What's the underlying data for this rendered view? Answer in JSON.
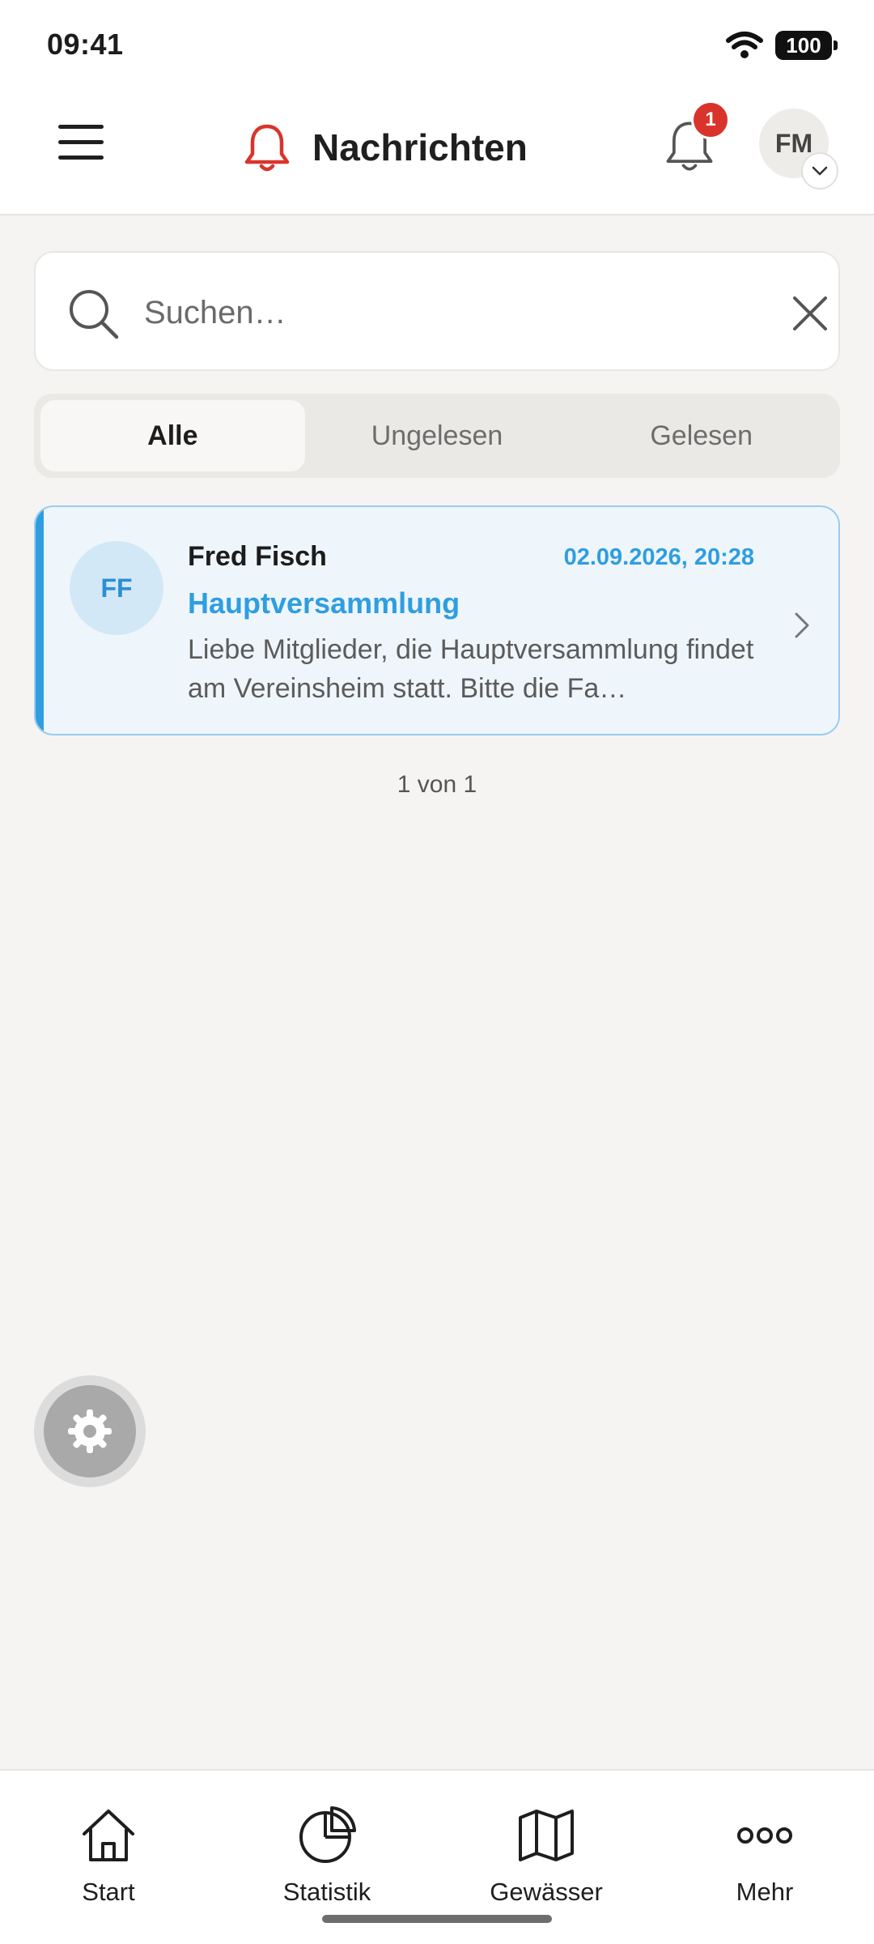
{
  "status_bar": {
    "time": "09:41",
    "battery": "100"
  },
  "header": {
    "title": "Nachrichten",
    "notification_count": "1",
    "user_initials": "FM"
  },
  "search": {
    "placeholder": "Suchen…",
    "value": ""
  },
  "tabs": [
    {
      "label": "Alle",
      "active": true
    },
    {
      "label": "Ungelesen",
      "active": false
    },
    {
      "label": "Gelesen",
      "active": false
    }
  ],
  "messages": [
    {
      "initials": "FF",
      "sender": "Fred Fisch",
      "date": "02.09.2026, 20:28",
      "subject": "Hauptversammlung",
      "preview": "Liebe Mitglieder, die Hauptversammlung findet am Vereinsheim statt. Bitte die Fa…"
    }
  ],
  "pagination": "1 von 1",
  "bottom_nav": [
    {
      "label": "Start",
      "icon": "home-icon"
    },
    {
      "label": "Statistik",
      "icon": "pie-chart-icon"
    },
    {
      "label": "Gewässer",
      "icon": "map-icon"
    },
    {
      "label": "Mehr",
      "icon": "more-dots-icon"
    }
  ],
  "colors": {
    "accent": "#2f9ee0",
    "bell_red": "#d9342b",
    "background": "#f5f4f2"
  }
}
